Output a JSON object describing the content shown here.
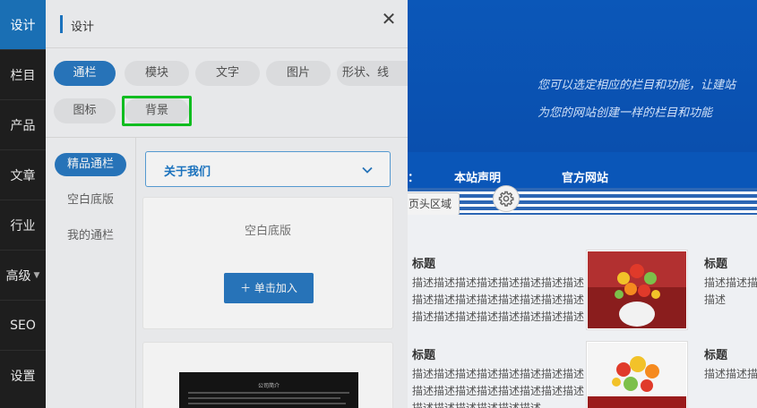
{
  "nav": {
    "items": [
      {
        "label": "设计",
        "active": true
      },
      {
        "label": "栏目"
      },
      {
        "label": "产品"
      },
      {
        "label": "文章"
      },
      {
        "label": "行业"
      },
      {
        "label": "高级"
      },
      {
        "label": "SEO"
      },
      {
        "label": "设置"
      }
    ]
  },
  "panel": {
    "title": "设计",
    "close_icon": "close-icon",
    "tabs": [
      {
        "label": "通栏",
        "active": true
      },
      {
        "label": "模块"
      },
      {
        "label": "文字"
      },
      {
        "label": "图片"
      },
      {
        "label": "形状、线"
      },
      {
        "label": "图标"
      },
      {
        "label": "背景",
        "highlighted": true
      }
    ],
    "categories": [
      {
        "label": "精品通栏",
        "active": true
      },
      {
        "label": "空白底版"
      },
      {
        "label": "我的通栏"
      }
    ],
    "dropdown": {
      "value": "关于我们"
    },
    "card1": {
      "title": "空白底版",
      "add_label": "＋ 单击加入"
    },
    "card2": {
      "preview_title": "公司简介"
    }
  },
  "site": {
    "hero_line1": "您可以选定相应的栏目和功能，让建站",
    "hero_line2": "为您的网站创建一样的栏目和功能",
    "menu": [
      "本站声明",
      "官方网站"
    ],
    "region_label": "页头区域",
    "articles": [
      {
        "title": "标题",
        "desc": "描述描述描述描述描述描述描述描述描述描述描述描述描述描述描述描述描述描述描述描述描述描述描述描述"
      },
      {
        "title": "标题",
        "desc": "描述描述描述描述描述描述描述描述描述描述描述描述描述描述描述描述描述描述描述描述描述描述"
      }
    ],
    "articles_right": [
      {
        "title": "标题",
        "desc": "描述描述描述描述描述描述描述描述描述"
      },
      {
        "title": "标题",
        "desc": "描述描述描述描述描述"
      }
    ]
  },
  "colors": {
    "accent": "#2a7ac2",
    "highlight": "#12c822",
    "nav_bg": "#1e1e1e",
    "hero": "#0b57b8"
  }
}
